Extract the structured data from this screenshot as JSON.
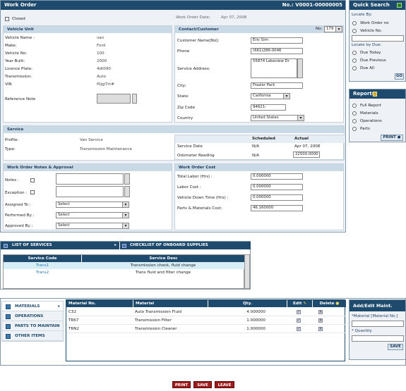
{
  "header": {
    "title": "Work Order",
    "number_label": "No.:",
    "number": "V0001-00000005",
    "date_label": "Work Order Date:",
    "date": "Apr 07, 2008",
    "closed_label": "Closed"
  },
  "vehicle": {
    "title": "Vehicle Unit",
    "rows": [
      {
        "label": "Vehicle Name :",
        "value": "van"
      },
      {
        "label": "Make:",
        "value": "Ford"
      },
      {
        "label": "Vehicle No:",
        "value": "100"
      },
      {
        "label": "Year Built:",
        "value": "2000"
      },
      {
        "label": "Licence Plate:",
        "value": "4dt090"
      },
      {
        "label": "Transmission:",
        "value": "Auto"
      },
      {
        "label": "VIN",
        "value": "f0jgi7rt#"
      }
    ],
    "ref_note_label": "Reference Note"
  },
  "contact": {
    "title": "Contact/Customer",
    "no_label": "No:",
    "no_value": "179",
    "customer_label": "Customer Name[No]:",
    "customer": "Eric Sim",
    "phone_label": "Phone",
    "phone": "(661)286-0046",
    "address_label": "Service Address:",
    "address": "55874 Lakeview Dr",
    "city_label": "City:",
    "city": "Frazier Park",
    "state_label": "State:",
    "state": "California",
    "zip_label": "Zip Code",
    "zip": "94621-",
    "country_label": "Country",
    "country": "United States"
  },
  "service": {
    "title": "Service",
    "profile_label": "Profile:",
    "profile": "Van Service",
    "type_label": "Type:",
    "type": "Transmission Maintenance",
    "col_scheduled": "Scheduled",
    "col_actual": "Actual",
    "date_label": "Service Date",
    "date_sched": "N/A",
    "date_actual": "Apr 07, 2008",
    "odo_label": "Odometer Reading",
    "odo_sched": "N/A",
    "odo_actual": "22500.0000"
  },
  "notes": {
    "title": "Work Order Notes & Approval",
    "notes_label": "Notes :",
    "exception_label": "Exception :",
    "assigned_label": "Assigned To :",
    "performed_label": "Performed By :",
    "approved_label": "Approved By :",
    "select": "Select"
  },
  "cost": {
    "title": "Work Order Cost",
    "rows": [
      {
        "label": "Total Labor (Hrs) :",
        "value": "0.000000"
      },
      {
        "label": "Labor Cost :",
        "value": "0.000000"
      },
      {
        "label": "Vehicle Down Time (Hrs) :",
        "value": "0.000000"
      },
      {
        "label": "Parts & Materials Cost:",
        "value": "46.160000"
      }
    ]
  },
  "quick": {
    "title": "Quick Search",
    "locate_by": "Locate By:",
    "opt1": "Work Order no",
    "opt2": "Vehicle No.",
    "locate_due": "Locate by Due:",
    "due1": "Due Today",
    "due2": "Due Previous",
    "due3": "Due All",
    "go": "GO"
  },
  "reports": {
    "title": "Reports",
    "items": [
      "Full Report",
      "Materials",
      "Operations",
      "Parts"
    ],
    "print": "PRINT"
  },
  "services_tabs": {
    "tab1": "LIST OF SERVICES",
    "tab2": "CHECKLIST OF ONBOARD SUPPLIES",
    "col1": "Service Code",
    "col2": "Service Desc",
    "rows": [
      {
        "code": "Trans1",
        "desc": "Transmission check, fluid change"
      },
      {
        "code": "Trans2",
        "desc": "Trans fluid and filter change"
      }
    ]
  },
  "side_nav": [
    "MATERIALS",
    "OPERATIONS",
    "PARTS TO MAINTAIN",
    "OTHER ITEMS"
  ],
  "materials": {
    "cols": [
      "Material No.",
      "Material",
      "Qty.",
      "Edit",
      "Delete"
    ],
    "rows": [
      {
        "no": "C32",
        "name": "Auto Transmission Fluid",
        "qty": "4.000000"
      },
      {
        "no": "TR67",
        "name": "Transmission Filter",
        "qty": "1.000000"
      },
      {
        "no": "TRN2",
        "name": "Transmission Cleaner",
        "qty": "1.000000"
      }
    ]
  },
  "add_edit": {
    "title": "Add/Edit Maint.",
    "material_label": "*Material [Material No.]",
    "qty_label": "* Quantity",
    "save": "SAVE"
  },
  "footer": {
    "print": "PRINT",
    "save": "SAVE",
    "leave": "LEAVE"
  }
}
